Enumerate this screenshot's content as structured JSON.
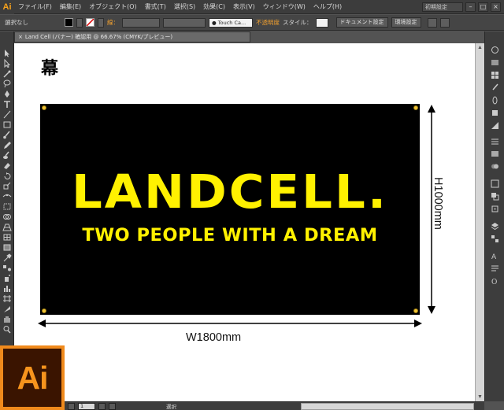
{
  "app": {
    "logo_text": "Ai",
    "big_logo_text": "Ai",
    "accent_color": "#f7941d"
  },
  "menubar": {
    "items": [
      "ファイル(F)",
      "編集(E)",
      "オブジェクト(O)",
      "書式(T)",
      "選択(S)",
      "効果(C)",
      "表示(V)",
      "ウィンドウ(W)",
      "ヘルプ(H)"
    ],
    "workspace": "初期設定",
    "window_buttons": [
      "–",
      "□",
      "×"
    ]
  },
  "controlbar": {
    "selection_label": "選択なし",
    "stroke_label": "線：",
    "brush_name": "Touch Ca...",
    "opacity_label": "不透明度",
    "style_label": "スタイル：",
    "document_setup": "ドキュメント設定",
    "preferences": "環境設定"
  },
  "document": {
    "tab_title": "Land Cell (バナー) 確認用 @ 66.67% (CMYK/プレビュー)",
    "close_glyph": "×"
  },
  "artboard": {
    "heading": "幕",
    "banner_title": "LANDCELL.",
    "banner_subtitle": "TWO PEOPLE WITH A DREAM",
    "banner_bg": "#000000",
    "text_color": "#fff100",
    "width_label": "W1800mm",
    "height_label": "H1000mm"
  },
  "statusbar": {
    "page": "1",
    "mode": "選択"
  }
}
